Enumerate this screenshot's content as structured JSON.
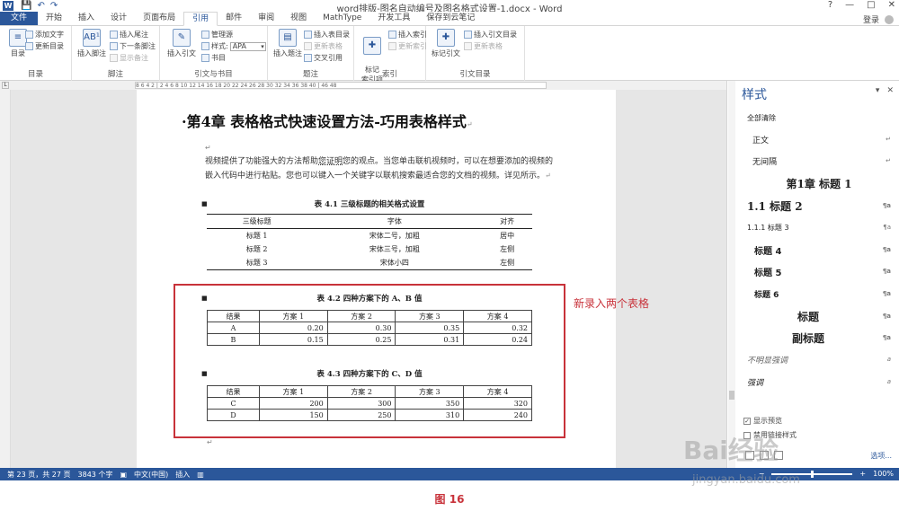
{
  "window": {
    "title": "word排版-图名自动编号及图名格式设置-1.docx - Word",
    "controls": [
      "?",
      "—",
      "□",
      "✕"
    ]
  },
  "qat": {
    "save": "💾",
    "undo": "↶",
    "redo": "↷"
  },
  "tabs": [
    "文件",
    "开始",
    "插入",
    "设计",
    "页面布局",
    "引用",
    "邮件",
    "审阅",
    "视图",
    "MathType",
    "开发工具",
    "保存到云笔记"
  ],
  "active_tab": "引用",
  "account": {
    "login": "登录"
  },
  "ribbon": {
    "toc": {
      "label": "目录",
      "big": "目录",
      "add_text": "添加文字",
      "update_toc": "更新目录"
    },
    "footnotes": {
      "label": "脚注",
      "insert_footnote": "插入脚注",
      "insert_endnote": "插入尾注",
      "next_footnote": "下一条脚注",
      "show_notes": "显示备注"
    },
    "citations": {
      "label": "引文与书目",
      "insert_citation": "插入引文",
      "manage_sources": "管理源",
      "style_label": "样式:",
      "style_value": "APA",
      "bibliography": "书目"
    },
    "captions": {
      "label": "题注",
      "insert_caption": "插入题注",
      "insert_tof": "插入表目录",
      "update_table": "更新表格",
      "cross_ref": "交叉引用"
    },
    "index": {
      "label": "索引",
      "mark_entry": "标记\n索引项",
      "insert_index": "插入索引",
      "update_index": "更新索引"
    },
    "toa": {
      "label": "引文目录",
      "mark_citation": "标记引文",
      "insert_toa": "插入引文目录",
      "update_toa": "更新表格"
    }
  },
  "ruler": {
    "text": "8  6  4  2  |  2  4  6  8  10  12  14  16  18  20  22  24  26  28  30  32  34  36  38  40  |  46  48"
  },
  "document": {
    "heading": "·第4章  表格格式快速设置方法-巧用表格样式",
    "para_mark": "↵",
    "paragraph_pre": "视频提供了功能强大的方法帮助",
    "paragraph_link": "您证明",
    "paragraph_post": "您的观点。当您单击联机视频时，可以在想要添加的视频的嵌入代码中进行粘贴。您也可以键入一个关键字以联机搜索最适合您的文档的视频。详见所示。",
    "table1": {
      "caption": "表 4.1  三级标题的相关格式设置",
      "headers": [
        "三级标题",
        "字体",
        "对齐"
      ],
      "rows": [
        [
          "标题 1",
          "宋体二号，加粗",
          "居中"
        ],
        [
          "标题 2",
          "宋体三号，加粗",
          "左侧"
        ],
        [
          "标题 3",
          "宋体小四",
          "左侧"
        ]
      ]
    },
    "table2": {
      "caption": "表 4.2  四种方案下的 A、B 值",
      "headers": [
        "结果",
        "方案 1",
        "方案 2",
        "方案 3",
        "方案 4"
      ],
      "rows": [
        [
          "A",
          "0.20",
          "0.30",
          "0.35",
          "0.32"
        ],
        [
          "B",
          "0.15",
          "0.25",
          "0.31",
          "0.24"
        ]
      ]
    },
    "table3": {
      "caption": "表 4.3  四种方案下的 C、D 值",
      "headers": [
        "结果",
        "方案 1",
        "方案 2",
        "方案 3",
        "方案 4"
      ],
      "rows": [
        [
          "C",
          "200",
          "300",
          "350",
          "320"
        ],
        [
          "D",
          "150",
          "250",
          "310",
          "240"
        ]
      ]
    },
    "annotation": "新录入两个表格"
  },
  "styles_pane": {
    "title": "样式",
    "items": [
      {
        "name": "全部清除",
        "mark": ""
      },
      {
        "name": "正文",
        "mark": "↵"
      },
      {
        "name": "无间隔",
        "mark": "↵"
      },
      {
        "name": "第1章  标题 1",
        "mark": ""
      },
      {
        "name": "1.1  标题 2",
        "mark": "¶a"
      },
      {
        "name": "1.1.1  标题 3",
        "mark": "¶a"
      },
      {
        "name": "标题 4",
        "mark": "¶a"
      },
      {
        "name": "标题 5",
        "mark": "¶a"
      },
      {
        "name": "标题 6",
        "mark": "¶a"
      },
      {
        "name": "标题",
        "mark": "¶a"
      },
      {
        "name": "副标题",
        "mark": "¶a"
      },
      {
        "name": "不明显强调",
        "mark": "a"
      },
      {
        "name": "强调",
        "mark": "a"
      }
    ],
    "show_preview": "显示预览",
    "disable_linked": "禁用链接样式",
    "options": "选项..."
  },
  "status": {
    "page": "第 23 页，共 27 页",
    "words": "3843 个字",
    "lang": "中文(中国)",
    "mode": "插入",
    "zoom": "100%"
  },
  "figure_caption": "图 16",
  "watermark": {
    "logo": "Bai经验",
    "url": "jingyan.baidu.com"
  }
}
